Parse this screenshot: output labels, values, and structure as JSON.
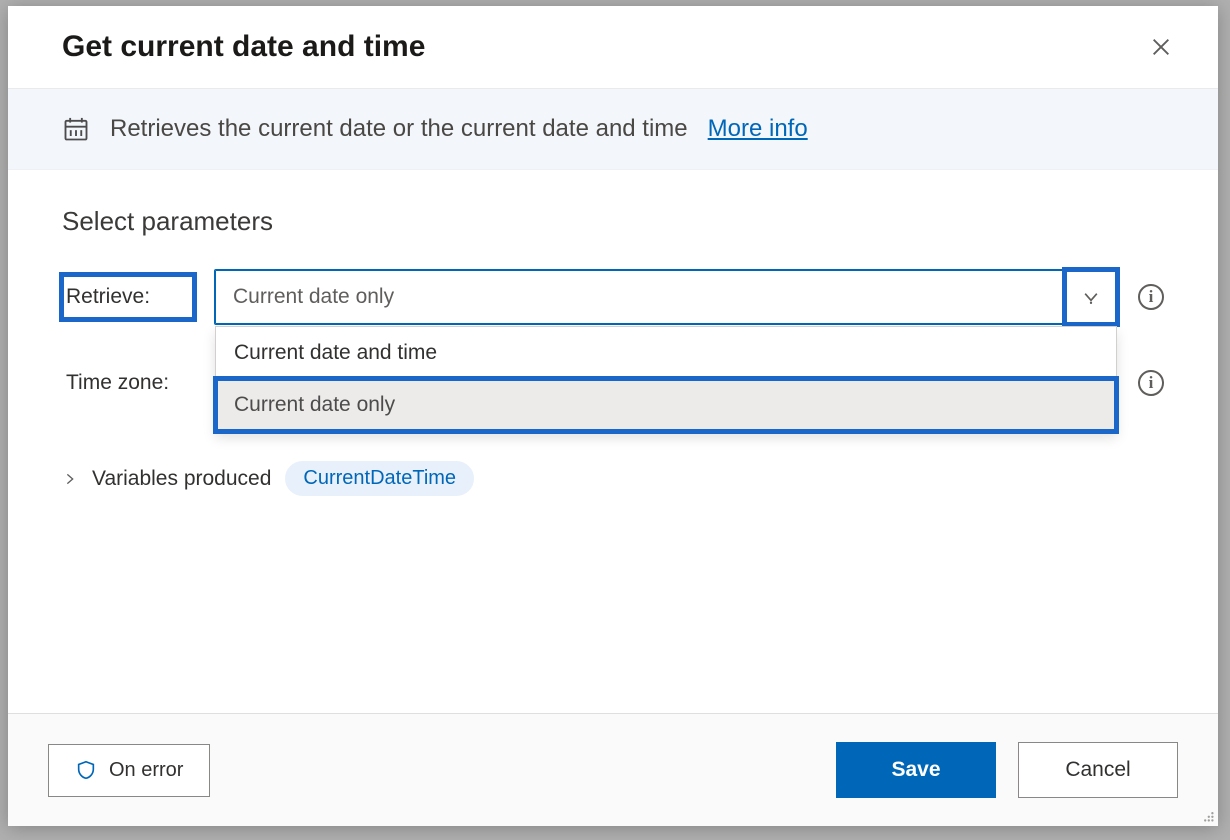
{
  "dialog": {
    "title": "Get current date and time",
    "description": "Retrieves the current date or the current date and time",
    "more_info": "More info"
  },
  "section": {
    "header": "Select parameters"
  },
  "params": {
    "retrieve": {
      "label": "Retrieve:",
      "value": "Current date only",
      "options": [
        "Current date and time",
        "Current date only"
      ]
    },
    "timezone": {
      "label": "Time zone:"
    }
  },
  "variables": {
    "label": "Variables produced",
    "produced": "CurrentDateTime"
  },
  "footer": {
    "on_error": "On error",
    "save": "Save",
    "cancel": "Cancel"
  },
  "icons": {
    "info": "i"
  }
}
